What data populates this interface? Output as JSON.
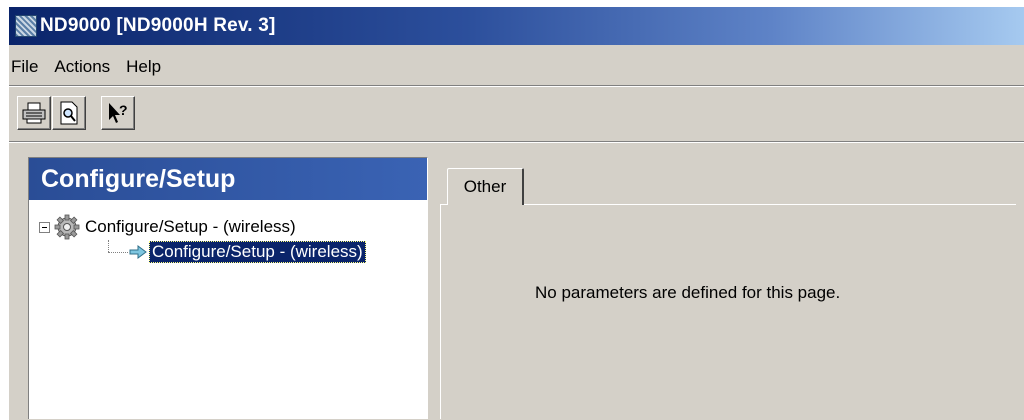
{
  "window": {
    "title": "ND9000 [ND9000H Rev. 3]"
  },
  "menu": [
    {
      "label": "File"
    },
    {
      "label": "Actions"
    },
    {
      "label": "Help"
    }
  ],
  "toolbar": {
    "buttons": [
      {
        "icon": "print-icon"
      },
      {
        "icon": "print-preview-icon"
      },
      {
        "icon": "context-help-icon"
      }
    ]
  },
  "left_panel": {
    "title": "Configure/Setup",
    "tree": {
      "root": {
        "label": "Configure/Setup - (wireless)",
        "icon": "gear-icon",
        "expanded": true
      },
      "child": {
        "label": "Configure/Setup - (wireless)",
        "icon": "arrow-right-icon",
        "selected": true
      }
    }
  },
  "tabs": [
    {
      "label": "Other",
      "active": true
    }
  ],
  "content": {
    "message": "No parameters are defined for this page."
  },
  "colors": {
    "title_bar_start": "#0a246a",
    "title_bar_end": "#a6caf0",
    "panel_header": "#2a4d96",
    "selection": "#0a246a",
    "window_bg": "#d4d0c8"
  }
}
